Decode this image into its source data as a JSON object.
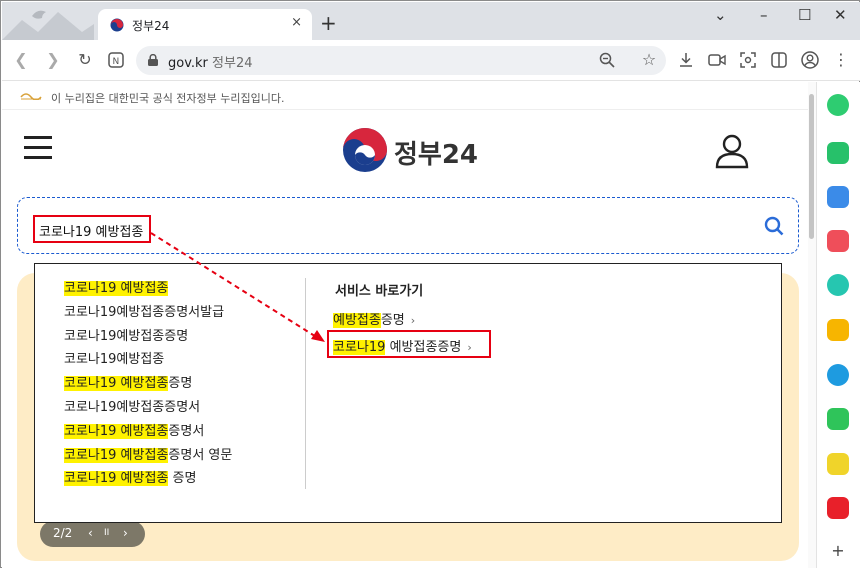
{
  "browser": {
    "tab_title": "정부24",
    "tab_close": "×",
    "new_tab": "+",
    "window_controls": {
      "minimize": "–",
      "restore": "☐",
      "close": "✕",
      "tab_list": "⌄"
    },
    "url_domain": "gov.kr",
    "url_title": "정부24",
    "toolbar_icons": [
      "back-icon",
      "forward-icon",
      "reload-icon",
      "new-tab-page-icon",
      "zoom-icon",
      "favorites-icon",
      "download-icon",
      "capture-icon",
      "screenshot-icon",
      "split-icon",
      "profile-icon",
      "menu-icon"
    ]
  },
  "site": {
    "gov_notice": "이 누리집은 대한민국 공식 전자정부 누리집입니다.",
    "logo_text": "정부24",
    "search_value": "코로나19 예방접종"
  },
  "suggestions": [
    {
      "hl": "코로나19 예방접종",
      "rest": ""
    },
    {
      "hl": "",
      "rest": "코로나19예방접종증명서발급"
    },
    {
      "hl": "",
      "rest": "코로나19예방접종증명"
    },
    {
      "hl": "",
      "rest": "코로나19예방접종"
    },
    {
      "hl": "코로나19 예방접종",
      "rest": "증명"
    },
    {
      "hl": "",
      "rest": "코로나19예방접종증명서"
    },
    {
      "hl": "코로나19 예방접종",
      "rest": "증명서"
    },
    {
      "hl": "코로나19 예방접종",
      "rest": "증명서 영문"
    },
    {
      "hl": "코로나19 예방접종",
      "rest": " 증명"
    }
  ],
  "services": {
    "title": "서비스 바로가기",
    "items": [
      {
        "hl": "예방접종",
        "rest": "증명",
        "chev": "›"
      },
      {
        "hl": "코로나19",
        "rest": " 예방접종증명",
        "chev": "›"
      }
    ]
  },
  "pager": {
    "page": "2/2",
    "prev": "‹",
    "pause": "II",
    "next": "›"
  },
  "colors": {
    "accent_red": "#e60012",
    "highlight": "#fff200",
    "banner": "#feecc6",
    "pager_bg": "#7d7868"
  }
}
